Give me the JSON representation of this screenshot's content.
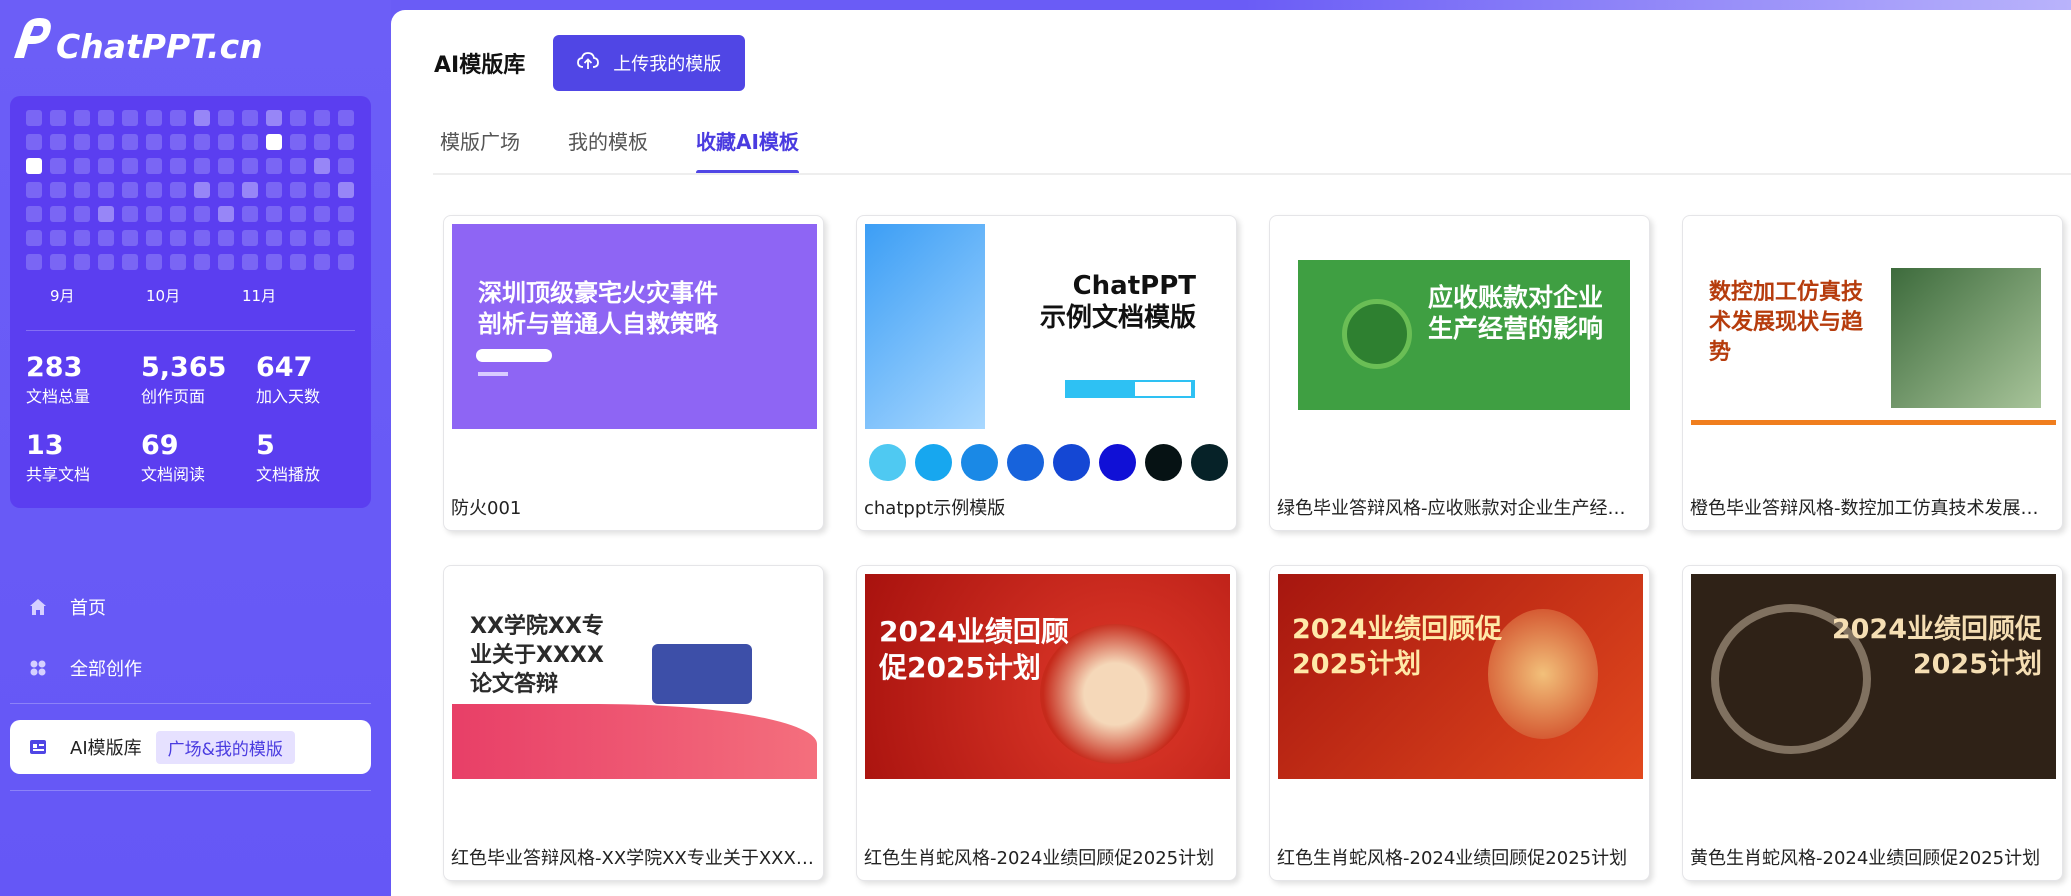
{
  "brand": {
    "logo_text": "ChatPPT.cn"
  },
  "sidebar": {
    "heatmap": {
      "rows": [
        [
          0,
          0,
          0,
          0,
          0,
          0,
          0,
          1,
          0,
          0,
          1,
          0,
          0,
          0
        ],
        [
          0,
          0,
          0,
          0,
          0,
          0,
          0,
          0,
          0,
          0,
          3,
          0,
          0,
          0
        ],
        [
          3,
          0,
          0,
          0,
          0,
          0,
          0,
          0,
          0,
          0,
          0,
          0,
          1,
          0
        ],
        [
          0,
          0,
          0,
          0,
          0,
          0,
          0,
          1,
          0,
          1,
          0,
          0,
          0,
          1
        ],
        [
          0,
          0,
          0,
          1,
          0,
          0,
          0,
          0,
          1,
          0,
          0,
          0,
          0,
          0
        ],
        [
          0,
          0,
          0,
          0,
          0,
          0,
          0,
          0,
          0,
          0,
          0,
          0,
          0,
          0
        ],
        [
          0,
          0,
          0,
          0,
          0,
          0,
          0,
          0,
          0,
          0,
          0,
          0,
          0,
          0
        ]
      ],
      "months": [
        "9月",
        "10月",
        "11月"
      ]
    },
    "stats": [
      {
        "value": "283",
        "label": "文档总量"
      },
      {
        "value": "5,365",
        "label": "创作页面"
      },
      {
        "value": "647",
        "label": "加入天数"
      },
      {
        "value": "13",
        "label": "共享文档"
      },
      {
        "value": "69",
        "label": "文档阅读"
      },
      {
        "value": "5",
        "label": "文档播放"
      }
    ],
    "nav": {
      "home": "首页",
      "all_creations": "全部创作",
      "template_lib": "AI模版库",
      "template_lib_pill": "广场&我的模版"
    }
  },
  "main": {
    "title": "AI模版库",
    "upload_label": "上传我的模版",
    "tabs": [
      "模版广场",
      "我的模板",
      "收藏AI模板"
    ],
    "cards": [
      {
        "title": "防火001",
        "thumb_text": [
          "深圳顶级豪宅火灾事件",
          "剖析与普通人自救策略"
        ]
      },
      {
        "title": "chatppt示例模版",
        "thumb_text": [
          "ChatPPT",
          "示例文档模版"
        ]
      },
      {
        "title": "绿色毕业答辩风格-应收账款对企业生产经营的影响",
        "thumb_text": [
          "应收账款对企业",
          "生产经营的影响"
        ]
      },
      {
        "title": "橙色毕业答辩风格-数控加工仿真技术发展现状与趋势",
        "thumb_text": [
          "数控加工仿真技",
          "术发展现状与趋",
          "势"
        ]
      },
      {
        "title": "红色毕业答辩风格-XX学院XX专业关于XXXX论文答辩",
        "thumb_text": [
          "XX学院XX专",
          "业关于XXXX",
          "论文答辩"
        ]
      },
      {
        "title": "红色生肖蛇风格-2024业绩回顾促2025计划",
        "thumb_text": [
          "2024业绩回顾",
          "促2025计划"
        ]
      },
      {
        "title": "红色生肖蛇风格-2024业绩回顾促2025计划",
        "thumb_text": [
          "2024业绩回顾促",
          "2025计划"
        ]
      },
      {
        "title": "黄色生肖蛇风格-2024业绩回顾促2025计划",
        "thumb_text": [
          "2024业绩回顾促",
          "2025计划"
        ]
      }
    ],
    "swatch_colors": [
      "#4fc9f2",
      "#17a7ef",
      "#1a89e6",
      "#1763dc",
      "#1447d4",
      "#1010d6",
      "#061214",
      "#062228"
    ]
  }
}
